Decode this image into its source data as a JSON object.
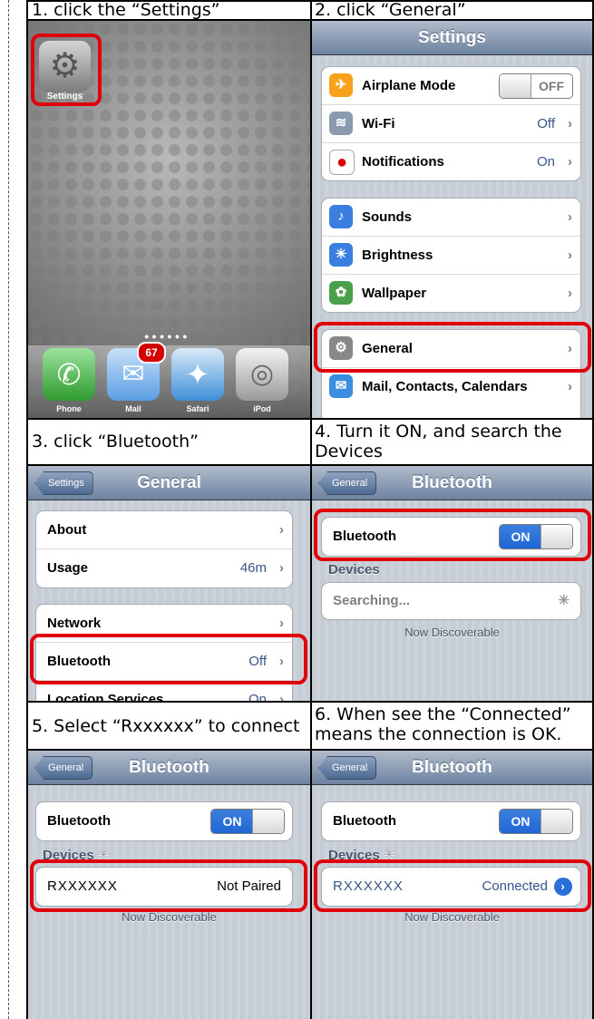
{
  "steps": {
    "s1": "1. click the “Settings”",
    "s2": "2. click “General”",
    "s3": "3. click “Bluetooth”",
    "s4": "4. Turn it ON, and search the Devices",
    "s5": "5. Select “Rxxxxxx” to connect",
    "s6": "6. When see the “Connected” means the connection is OK."
  },
  "home": {
    "settings_label": "Settings",
    "dock": [
      "Phone",
      "Mail",
      "Safari",
      "iPod"
    ],
    "mail_badge": "67"
  },
  "settings_screen": {
    "title": "Settings",
    "group1": [
      {
        "label": "Airplane Mode",
        "value": "OFF",
        "icon": "airplane-icon",
        "color": "#f7a21a"
      },
      {
        "label": "Wi-Fi",
        "value": "Off",
        "icon": "wifi-icon",
        "color": "#8a9bb0"
      },
      {
        "label": "Notifications",
        "value": "On",
        "icon": "notifications-icon",
        "color": "#d40000"
      }
    ],
    "group2": [
      {
        "label": "Sounds",
        "icon": "sounds-icon",
        "color": "#3a7fe0"
      },
      {
        "label": "Brightness",
        "icon": "brightness-icon",
        "color": "#3a7fe0"
      },
      {
        "label": "Wallpaper",
        "icon": "wallpaper-icon",
        "color": "#4aa04a"
      }
    ],
    "group3": [
      {
        "label": "General",
        "icon": "general-gear-icon",
        "color": "#888888"
      },
      {
        "label": "Mail, Contacts, Calendars",
        "icon": "mail-icon",
        "color": "#3a8ee0"
      }
    ]
  },
  "general_screen": {
    "back": "Settings",
    "title": "General",
    "about": "About",
    "usage": "Usage",
    "usage_value": "46m",
    "network": "Network",
    "bluetooth": "Bluetooth",
    "bluetooth_value": "Off",
    "location": "Location Services",
    "location_value": "On"
  },
  "bt": {
    "back": "General",
    "title": "Bluetooth",
    "row_label": "Bluetooth",
    "toggle_on": "ON",
    "devices": "Devices",
    "searching": "Searching...",
    "discoverable": "Now Discoverable",
    "device_name": "RXXXXXX",
    "not_paired": "Not Paired",
    "connected": "Connected"
  },
  "colors": {
    "highlight": "#e0000b",
    "nav": "#6d83a1",
    "toggle_on": "#2a6fd9"
  }
}
